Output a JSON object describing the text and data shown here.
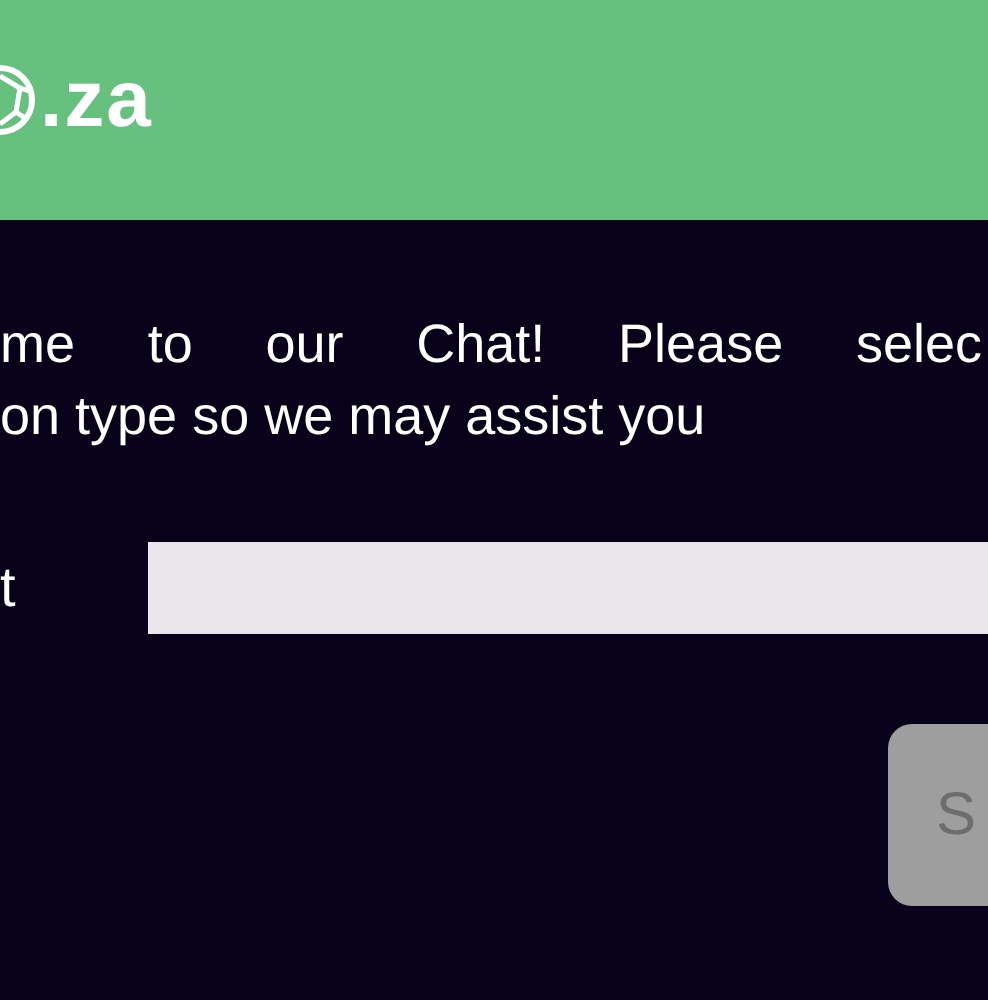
{
  "header": {
    "logo_text": ".za"
  },
  "intro_lines": [
    "me to our Chat! Please selec",
    "on type so we may assist you"
  ],
  "field": {
    "label": "t"
  },
  "button": {
    "label": "S"
  }
}
